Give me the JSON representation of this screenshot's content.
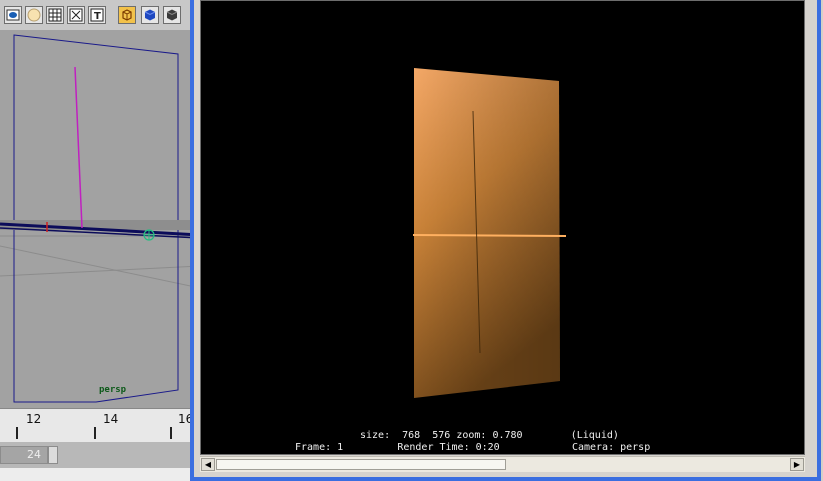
{
  "toolbar": {
    "tools": [
      {
        "name": "render-region-icon"
      },
      {
        "name": "sphere-light-icon"
      },
      {
        "name": "grid-icon"
      },
      {
        "name": "uv-points-icon"
      },
      {
        "name": "text-icon"
      },
      {
        "name": "shaded-cube-wireframe-icon"
      },
      {
        "name": "smooth-shade-cube-icon"
      },
      {
        "name": "flat-shade-cube-icon"
      }
    ]
  },
  "viewport": {
    "camera_label": "persp"
  },
  "timeline": {
    "ticks": [
      "12",
      "14",
      "16"
    ]
  },
  "range": {
    "end_value": "24"
  },
  "render_view": {
    "info_line1": "size:  768  576 zoom: 0.780        (Liquid)",
    "info_line2": "Frame: 1         Render Time: 0:20            Camera: persp"
  },
  "colors": {
    "window_border": "#3a6ee0",
    "render_bg": "#000000",
    "plane_light": "#f4a867",
    "plane_dark": "#6e4518",
    "viewport_bg": "#a2a2a2",
    "wire_blue": "#1a1a8a",
    "magenta_edge": "#c020c0"
  }
}
